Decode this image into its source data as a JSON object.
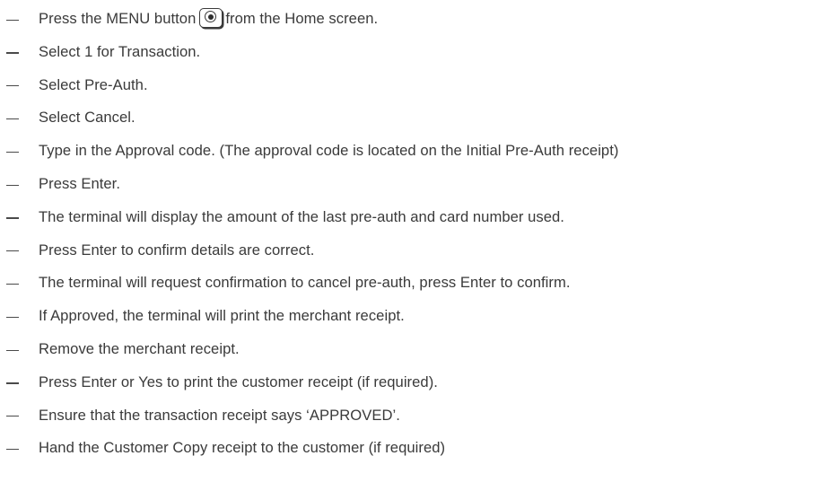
{
  "steps": [
    {
      "before": "Press the MENU button",
      "after": "from the Home screen."
    },
    {
      "text": "Select 1 for Transaction."
    },
    {
      "text": "Select Pre-Auth."
    },
    {
      "text": "Select Cancel."
    },
    {
      "text": "Type in the Approval code. (The approval code is located on the Initial Pre-Auth receipt)"
    },
    {
      "text": "Press Enter."
    },
    {
      "text": "The terminal will display the amount of the last pre-auth and card number used."
    },
    {
      "text": "Press Enter to confirm details are correct."
    },
    {
      "text": "The terminal will request confirmation to cancel pre-auth, press Enter to confirm."
    },
    {
      "text": "If Approved, the terminal will print the merchant receipt."
    },
    {
      "text": "Remove the merchant receipt."
    },
    {
      "text": "Press Enter or Yes to print the customer receipt (if required)."
    },
    {
      "text": "Ensure that the transaction receipt says ‘APPROVED’."
    },
    {
      "text": "Hand the Customer Copy receipt to the customer (if required)"
    }
  ],
  "icons": {
    "menu_button": "menu-button-icon"
  }
}
